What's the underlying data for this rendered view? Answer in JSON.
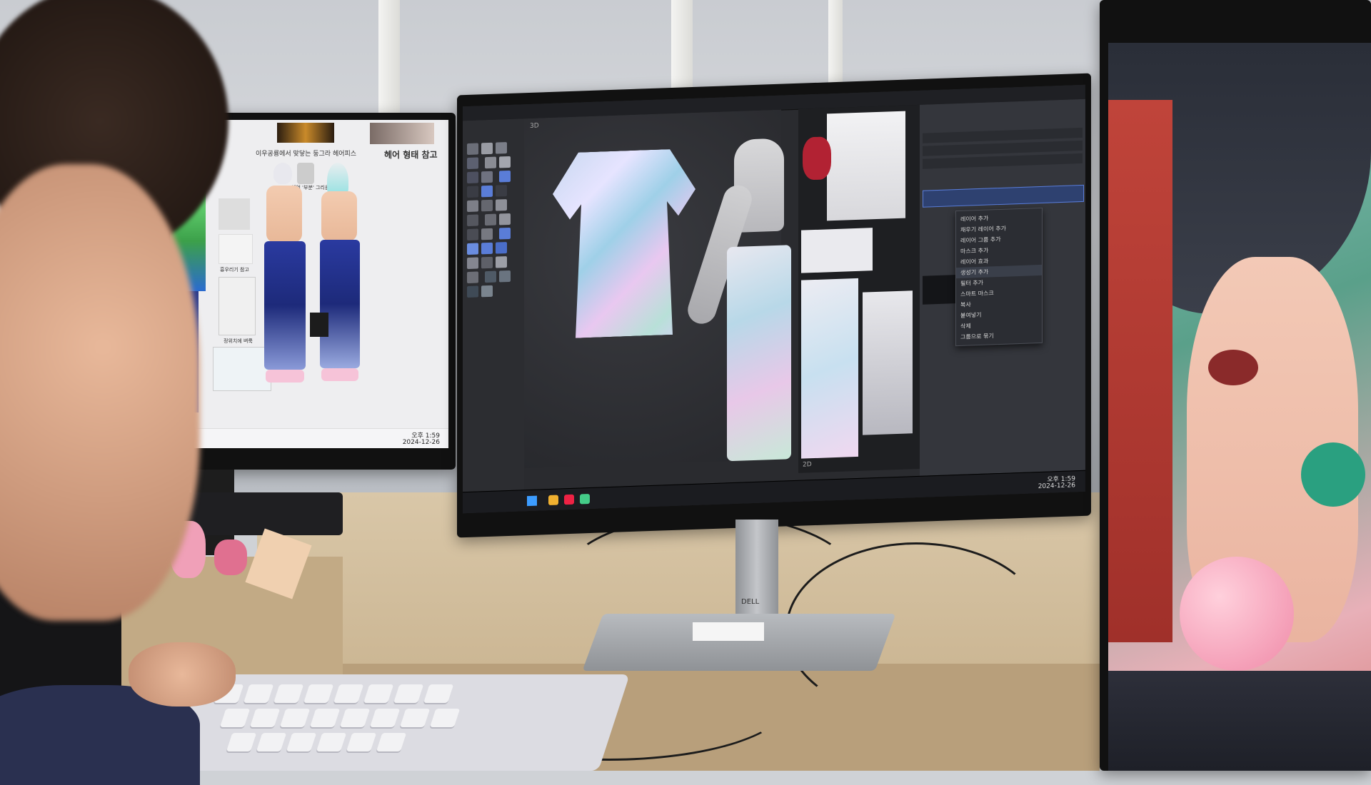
{
  "left_monitor": {
    "captions": {
      "top_left": "이우공룡에서 맞닿는 둥그라 헤어피스",
      "top_right": "헤어 형태 참고",
      "side_note_1": "헤어 '부분' 그리움 참고",
      "side_note_2": "흉우리기 참고",
      "bottom_note": "정위치에 벼룩"
    },
    "taskbar_time": "오후 1:59",
    "taskbar_date": "2024-12-26"
  },
  "center_monitor": {
    "app": "3D texturing software",
    "context_menu_items": [
      "레이어 추가",
      "채우기 레이어 추가",
      "레이어 그룹 추가",
      "마스크 추가",
      "레이어 효과",
      "생성기 추가",
      "필터 추가",
      "스마트 마스크",
      "복사",
      "붙여넣기",
      "삭제",
      "그룹으로 묶기"
    ],
    "active_menu_index": 5,
    "viewport_label": "3D",
    "uv_label": "2D",
    "taskbar_time": "오후 1:59",
    "taskbar_date": "2024-12-26",
    "brand": "DELL"
  },
  "right_monitor": {
    "subject": "anime-style illustration of a character blowing bubble gum"
  },
  "colors": {
    "wall": "#cfd2d6",
    "desk": "#d9c7a8",
    "app_bg": "#2a2b2f",
    "panel": "#34363c",
    "accent": "#5a7dd8"
  }
}
